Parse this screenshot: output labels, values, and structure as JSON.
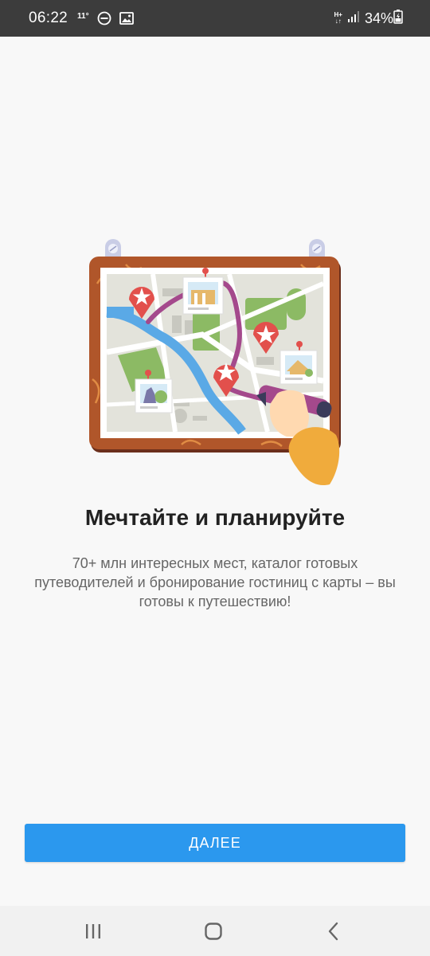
{
  "status_bar": {
    "time": "06:22",
    "temperature": "11°",
    "network_type": "H+",
    "battery": "34%",
    "icons": [
      "do-not-disturb-icon",
      "image-icon",
      "network-type-icon",
      "signal-icon",
      "battery-icon"
    ]
  },
  "onboarding": {
    "illustration": "map-planning-illustration",
    "title": "Мечтайте и планируйте",
    "description": "70+ млн интересных мест, каталог готовых путеводителей и бронирование гостиниц с карты – вы готовы к путешествию!"
  },
  "actions": {
    "next_label": "ДАЛЕЕ"
  },
  "colors": {
    "status_bar": "#3c3c3c",
    "background": "#f8f8f8",
    "accent": "#2b98ee",
    "frame": "#b0562a",
    "map_route": "#a4498c",
    "pin": "#e2504c"
  },
  "nav_bar": {
    "icons": [
      "recent-apps-icon",
      "home-icon",
      "back-icon"
    ]
  }
}
